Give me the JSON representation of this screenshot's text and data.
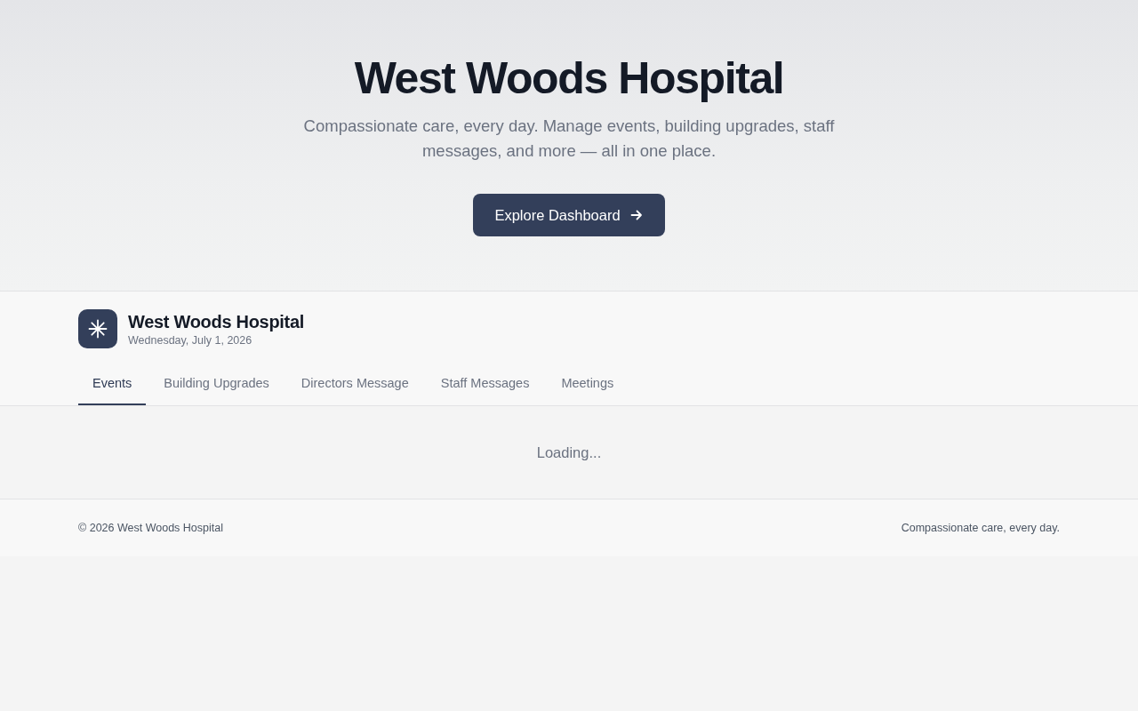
{
  "hero": {
    "title": "West Woods Hospital",
    "subtitle": "Compassionate care, every day. Manage events, building upgrades, staff messages, and more — all in one place.",
    "button": {
      "label": "Explore Dashboard"
    }
  },
  "header": {
    "title": "West Woods Hospital",
    "date": "Wednesday, July 1, 2026"
  },
  "tabs": [
    {
      "label": "Events",
      "selected": true
    },
    {
      "label": "Building Upgrades",
      "selected": false
    },
    {
      "label": "Directors Message",
      "selected": false
    },
    {
      "label": "Staff Messages",
      "selected": false
    },
    {
      "label": "Meetings",
      "selected": false
    }
  ],
  "content": {
    "status": "Loading..."
  },
  "footer": {
    "copyright": "© 2026 West Woods Hospital",
    "tagline": "Compassionate care, every day."
  }
}
